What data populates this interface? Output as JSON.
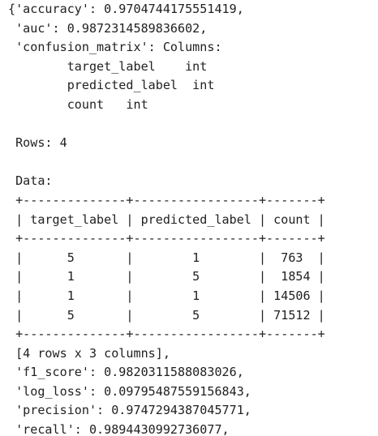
{
  "output": {
    "lines": [
      "{'accuracy': 0.9704744175551419,",
      " 'auc': 0.9872314589836602,",
      " 'confusion_matrix': Columns:",
      "        target_label    int",
      "        predicted_label  int",
      "        count   int",
      "",
      " Rows: 4",
      "",
      " Data:",
      " +--------------+-----------------+-------+",
      " | target_label | predicted_label | count |",
      " +--------------+-----------------+-------+",
      " |      5       |        1        |  763  |",
      " |      1       |        5        |  1854 |",
      " |      1       |        1        | 14506 |",
      " |      5       |        5        | 71512 |",
      " +--------------+-----------------+-------+",
      " [4 rows x 3 columns],",
      " 'f1_score': 0.9820311588083026,",
      " 'log_loss': 0.09795487559156843,",
      " 'precision': 0.9747294387045771,",
      " 'recall': 0.9894430992736077,"
    ]
  }
}
